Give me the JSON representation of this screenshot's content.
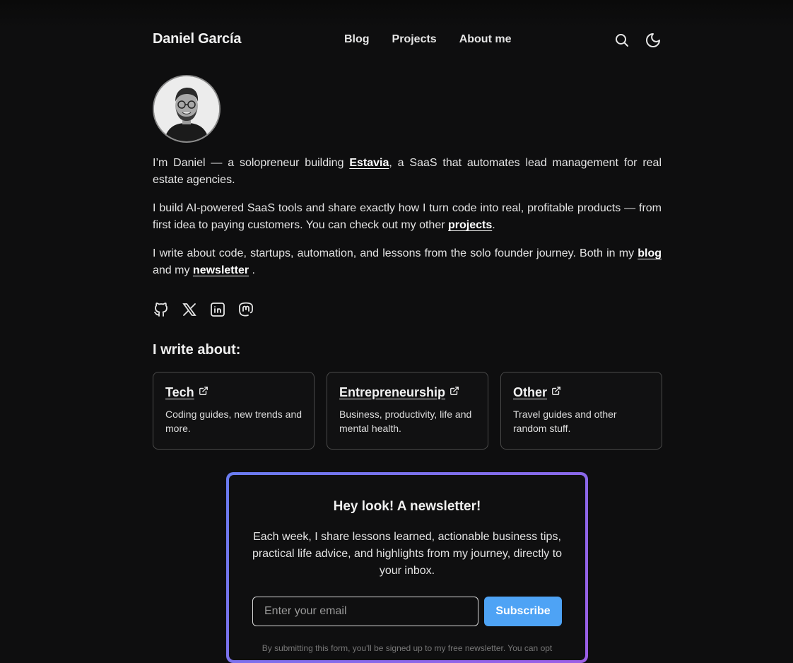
{
  "header": {
    "site_title": "Daniel García",
    "nav": [
      "Blog",
      "Projects",
      "About me"
    ],
    "icons": [
      "search-icon",
      "moon-icon"
    ]
  },
  "intro": {
    "p1_before": "I’m Daniel — a solopreneur building ",
    "p1_link": "Estavia",
    "p1_after": ", a SaaS that automates lead management for real estate agencies.",
    "p2_before": "I build AI-powered SaaS tools and share exactly how I turn code into real, profitable products — from first idea to paying customers. You can check out my other ",
    "p2_link": "projects",
    "p2_after": ".",
    "p3_before": "I write about code, startups, automation, and lessons from the solo founder journey. Both in my ",
    "p3_link1": "blog",
    "p3_mid": " and my ",
    "p3_link2": "newsletter",
    "p3_after": " ."
  },
  "socials": [
    "github-icon",
    "x-icon",
    "linkedin-icon",
    "mastodon-icon"
  ],
  "write_about": {
    "title": "I write about:",
    "cards": [
      {
        "title": "Tech",
        "desc": "Coding guides, new trends and more."
      },
      {
        "title": "Entrepreneurship",
        "desc": "Business, productivity, life and mental health."
      },
      {
        "title": "Other",
        "desc": "Travel guides and other random stuff."
      }
    ]
  },
  "newsletter": {
    "title": "Hey look! A newsletter!",
    "text": "Each week, I share lessons learned, actionable business tips, practical life advice, and highlights from my journey, directly to your inbox.",
    "email_placeholder": "Enter your email",
    "button_label": "Subscribe",
    "disclaimer": "By submitting this form, you'll be signed up to my free newsletter. You can opt"
  },
  "colors": {
    "background": "#0e0e0f",
    "accent_button": "#4ea3f5",
    "border_gradient_start": "#6a7cf0",
    "border_gradient_end": "#9b5de5"
  }
}
